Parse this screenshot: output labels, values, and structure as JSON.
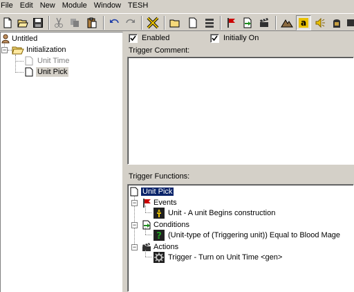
{
  "menu": [
    "File",
    "Edit",
    "New",
    "Module",
    "Window",
    "TESH"
  ],
  "toolbar": {
    "buttons": [
      "new-document-icon",
      "open-folder-icon",
      "save-disk-icon",
      "cut-scissors-icon",
      "copy-icon",
      "paste-clipboard-icon",
      "undo-icon",
      "redo-icon",
      "close-x-icon",
      "new-category-icon",
      "new-trigger-icon",
      "new-comment-icon",
      "new-event-icon",
      "new-condition-icon",
      "new-action-icon",
      "terrain-editor-icon",
      "text-editor-icon",
      "sound-editor-icon",
      "object-editor-icon",
      "ability-editor-icon"
    ]
  },
  "tree": {
    "root": "Untitled",
    "category": "Initialization",
    "triggers": [
      {
        "label": "Unit Time",
        "disabled": true
      },
      {
        "label": "Unit Pick",
        "selected": true
      }
    ]
  },
  "trigger": {
    "enabled_label": "Enabled",
    "enabled": true,
    "initially_on_label": "Initially On",
    "initially_on": true,
    "comment_label": "Trigger Comment:",
    "comment": "",
    "functions_label": "Trigger Functions:"
  },
  "functions": {
    "name": "Unit Pick",
    "events_label": "Events",
    "event": "Unit - A unit Begins construction",
    "conditions_label": "Conditions",
    "condition": "(Unit-type of (Triggering unit)) Equal to Blood Mage",
    "actions_label": "Actions",
    "action": "Trigger - Turn on Unit Time <gen>"
  },
  "colors": {
    "selection": "#0a246a",
    "face": "#d4d0c8",
    "event_flag": "#cc0000",
    "condition_green": "#1f8f1f"
  }
}
